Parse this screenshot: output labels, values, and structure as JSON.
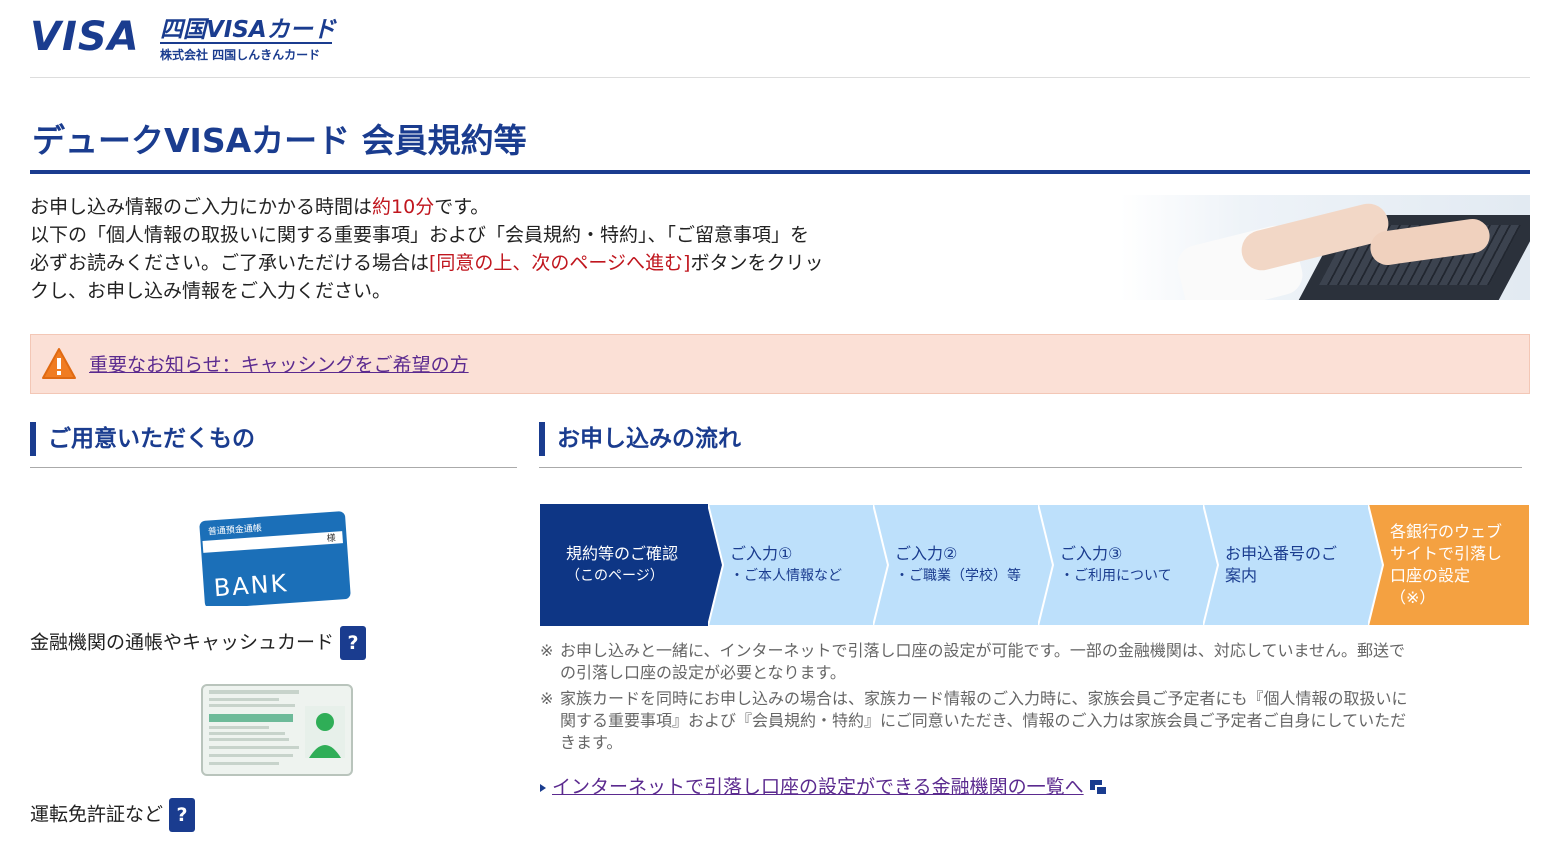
{
  "header": {
    "visa_logo": "VISA",
    "brand_main": "四国VISAカード",
    "brand_sub": "株式会社 四国しんきんカード"
  },
  "page": {
    "title": "デュークVISAカード 会員規約等"
  },
  "intro": {
    "line1_pre": "お申し込み情報のご入力にかかる時間は",
    "line1_red": "約10分",
    "line1_post": "です。",
    "line2": "以下の「個人情報の取扱いに関する重要事項」および「会員規約・特約」、「ご留意事項」を",
    "line3_pre": "必ずお読みください。ご了承いただける場合は",
    "line3_red": "[同意の上、次のページへ進む]",
    "line3_post": "ボタンをクリッ",
    "line4": "クし、お申し込み情報をご入力ください。"
  },
  "notice": {
    "link": "重要なお知らせ：キャッシングをご希望の方"
  },
  "prepare": {
    "heading": "ご用意いただくもの",
    "card_texts": {
      "title": "普通預金通帳",
      "sama": "様",
      "bank": "BANK"
    },
    "item1": "金融機関の通帳やキャッシュカード",
    "item2": "運転免許証など",
    "help": "?"
  },
  "flow": {
    "heading": "お申し込みの流れ",
    "steps": [
      {
        "line1": "規約等のご確認",
        "line2": "（このページ）"
      },
      {
        "line1": "ご入力①",
        "line2": "・ご本人情報など"
      },
      {
        "line1": "ご入力②",
        "line2": "・ご職業（学校）等"
      },
      {
        "line1": "ご入力③",
        "line2": "・ご利用について"
      },
      {
        "line1": "お申込番号のご",
        "line2": "案内"
      },
      {
        "line1": "各銀行のウェブ",
        "line2": "サイトで引落し",
        "line3": "口座の設定",
        "line4": "（※）"
      }
    ],
    "colors": {
      "current": "#0e3685",
      "pending": "#bde0fb",
      "external": "#f4a141"
    }
  },
  "notes": {
    "mark": "※",
    "note1_a": "お申し込みと一緒に、インターネットで引落し口座の設定が可能です。一部の金融機関は、対応していません。郵送で",
    "note1_b": "の引落し口座の設定が必要となります。",
    "note2_a": "家族カードを同時にお申し込みの場合は、家族カード情報のご入力時に、家族会員ご予定者にも『個人情報の取扱いに",
    "note2_b": "関する重要事項』および『会員規約・特約』にご同意いただき、情報のご入力は家族会員ご予定者ご自身にしていただ",
    "note2_c": "きます。"
  },
  "bank_list_link": "インターネットで引落し口座の設定ができる金融機関の一覧へ"
}
